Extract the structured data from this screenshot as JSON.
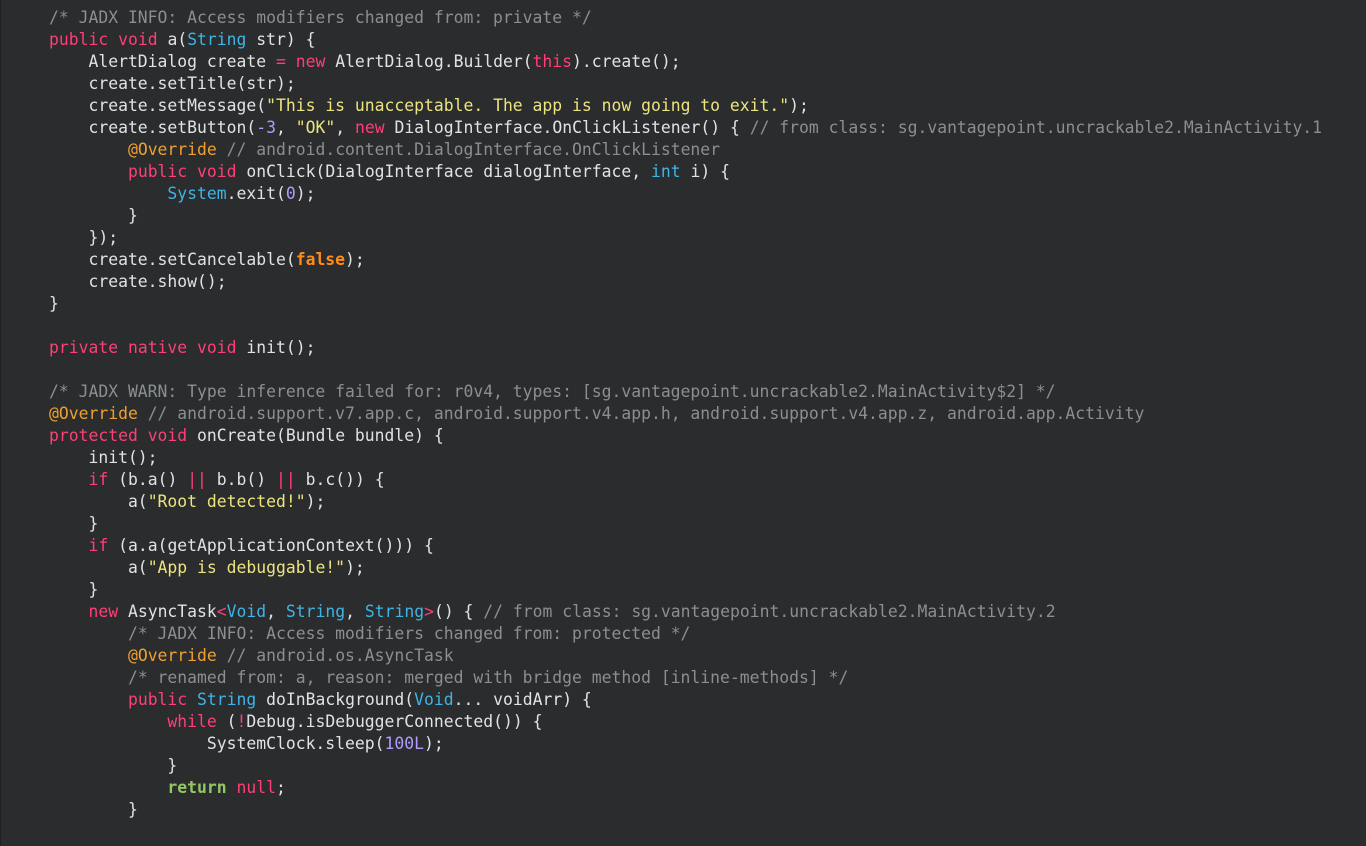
{
  "editor": {
    "theme_colors": {
      "background": "#2a2c2d",
      "comment": "#8a8f93",
      "keyword": "#ff3f77",
      "keyword_bold": "#93c763",
      "type": "#3fb4e6",
      "string": "#ece47e",
      "number": "#b39aff",
      "annotation": "#f0a030",
      "boolean": "#ff8c1a",
      "default": "#e0e2e4"
    },
    "lines": [
      [
        [
          "comment",
          "/* JADX INFO: Access modifiers changed from: private */"
        ]
      ],
      [
        [
          "kw",
          "public"
        ],
        [
          "plain",
          " "
        ],
        [
          "kw",
          "void"
        ],
        [
          "plain",
          " a("
        ],
        [
          "type",
          "String"
        ],
        [
          "plain",
          " str) {"
        ]
      ],
      [
        [
          "plain",
          "    AlertDialog create "
        ],
        [
          "ops",
          "="
        ],
        [
          "plain",
          " "
        ],
        [
          "kw",
          "new"
        ],
        [
          "plain",
          " AlertDialog.Builder("
        ],
        [
          "kw",
          "this"
        ],
        [
          "plain",
          ").create();"
        ]
      ],
      [
        [
          "plain",
          "    create.setTitle(str);"
        ]
      ],
      [
        [
          "plain",
          "    create.setMessage("
        ],
        [
          "str",
          "\"This is unacceptable. The app is now going to exit.\""
        ],
        [
          "plain",
          ");"
        ]
      ],
      [
        [
          "plain",
          "    create.setButton("
        ],
        [
          "num",
          "-3"
        ],
        [
          "plain",
          ", "
        ],
        [
          "str",
          "\"OK\""
        ],
        [
          "plain",
          ", "
        ],
        [
          "kw",
          "new"
        ],
        [
          "plain",
          " DialogInterface.OnClickListener() { "
        ],
        [
          "comment",
          "// from class: sg.vantagepoint.uncrackable2.MainActivity.1"
        ]
      ],
      [
        [
          "plain",
          "        "
        ],
        [
          "anno",
          "@Override"
        ],
        [
          "plain",
          " "
        ],
        [
          "comment",
          "// android.content.DialogInterface.OnClickListener"
        ]
      ],
      [
        [
          "plain",
          "        "
        ],
        [
          "kw",
          "public"
        ],
        [
          "plain",
          " "
        ],
        [
          "kw",
          "void"
        ],
        [
          "plain",
          " onClick(DialogInterface dialogInterface, "
        ],
        [
          "type",
          "int"
        ],
        [
          "plain",
          " i) {"
        ]
      ],
      [
        [
          "plain",
          "            "
        ],
        [
          "type",
          "System"
        ],
        [
          "plain",
          ".exit("
        ],
        [
          "num",
          "0"
        ],
        [
          "plain",
          ");"
        ]
      ],
      [
        [
          "plain",
          "        }"
        ]
      ],
      [
        [
          "plain",
          "    });"
        ]
      ],
      [
        [
          "plain",
          "    create.setCancelable("
        ],
        [
          "bool",
          "false"
        ],
        [
          "plain",
          ");"
        ]
      ],
      [
        [
          "plain",
          "    create.show();"
        ]
      ],
      [
        [
          "plain",
          "}"
        ]
      ],
      [
        [
          "plain",
          ""
        ]
      ],
      [
        [
          "kw",
          "private"
        ],
        [
          "plain",
          " "
        ],
        [
          "kw",
          "native"
        ],
        [
          "plain",
          " "
        ],
        [
          "kw",
          "void"
        ],
        [
          "plain",
          " init();"
        ]
      ],
      [
        [
          "plain",
          ""
        ]
      ],
      [
        [
          "comment",
          "/* JADX WARN: Type inference failed for: r0v4, types: [sg.vantagepoint.uncrackable2.MainActivity$2] */"
        ]
      ],
      [
        [
          "anno",
          "@Override"
        ],
        [
          "plain",
          " "
        ],
        [
          "comment",
          "// android.support.v7.app.c, android.support.v4.app.h, android.support.v4.app.z, android.app.Activity"
        ]
      ],
      [
        [
          "kw",
          "protected"
        ],
        [
          "plain",
          " "
        ],
        [
          "kw",
          "void"
        ],
        [
          "plain",
          " onCreate(Bundle bundle) {"
        ]
      ],
      [
        [
          "plain",
          "    init();"
        ]
      ],
      [
        [
          "plain",
          "    "
        ],
        [
          "kw",
          "if"
        ],
        [
          "plain",
          " (b.a() "
        ],
        [
          "ops",
          "||"
        ],
        [
          "plain",
          " b.b() "
        ],
        [
          "ops",
          "||"
        ],
        [
          "plain",
          " b.c()) {"
        ]
      ],
      [
        [
          "plain",
          "        a("
        ],
        [
          "str",
          "\"Root detected!\""
        ],
        [
          "plain",
          ");"
        ]
      ],
      [
        [
          "plain",
          "    }"
        ]
      ],
      [
        [
          "plain",
          "    "
        ],
        [
          "kw",
          "if"
        ],
        [
          "plain",
          " (a.a(getApplicationContext())) {"
        ]
      ],
      [
        [
          "plain",
          "        a("
        ],
        [
          "str",
          "\"App is debuggable!\""
        ],
        [
          "plain",
          ");"
        ]
      ],
      [
        [
          "plain",
          "    }"
        ]
      ],
      [
        [
          "plain",
          "    "
        ],
        [
          "kw",
          "new"
        ],
        [
          "plain",
          " AsyncTask"
        ],
        [
          "ops",
          "<"
        ],
        [
          "type",
          "Void"
        ],
        [
          "plain",
          ", "
        ],
        [
          "type",
          "String"
        ],
        [
          "plain",
          ", "
        ],
        [
          "type",
          "String"
        ],
        [
          "ops",
          ">"
        ],
        [
          "plain",
          "() { "
        ],
        [
          "comment",
          "// from class: sg.vantagepoint.uncrackable2.MainActivity.2"
        ]
      ],
      [
        [
          "plain",
          "        "
        ],
        [
          "comment",
          "/* JADX INFO: Access modifiers changed from: protected */"
        ]
      ],
      [
        [
          "plain",
          "        "
        ],
        [
          "anno",
          "@Override"
        ],
        [
          "plain",
          " "
        ],
        [
          "comment",
          "// android.os.AsyncTask"
        ]
      ],
      [
        [
          "plain",
          "        "
        ],
        [
          "comment",
          "/* renamed from: a, reason: merged with bridge method [inline-methods] */"
        ]
      ],
      [
        [
          "plain",
          "        "
        ],
        [
          "kw",
          "public"
        ],
        [
          "plain",
          " "
        ],
        [
          "type",
          "String"
        ],
        [
          "plain",
          " doInBackground("
        ],
        [
          "type",
          "Void"
        ],
        [
          "plain",
          "... voidArr) {"
        ]
      ],
      [
        [
          "plain",
          "            "
        ],
        [
          "kw",
          "while"
        ],
        [
          "plain",
          " ("
        ],
        [
          "ops",
          "!"
        ],
        [
          "plain",
          "Debug.isDebuggerConnected()) {"
        ]
      ],
      [
        [
          "plain",
          "                SystemClock.sleep("
        ],
        [
          "num",
          "100L"
        ],
        [
          "plain",
          ");"
        ]
      ],
      [
        [
          "plain",
          "            }"
        ]
      ],
      [
        [
          "plain",
          "            "
        ],
        [
          "kwb",
          "return"
        ],
        [
          "plain",
          " "
        ],
        [
          "kw",
          "null"
        ],
        [
          "plain",
          ";"
        ]
      ],
      [
        [
          "plain",
          "        }"
        ]
      ]
    ]
  }
}
